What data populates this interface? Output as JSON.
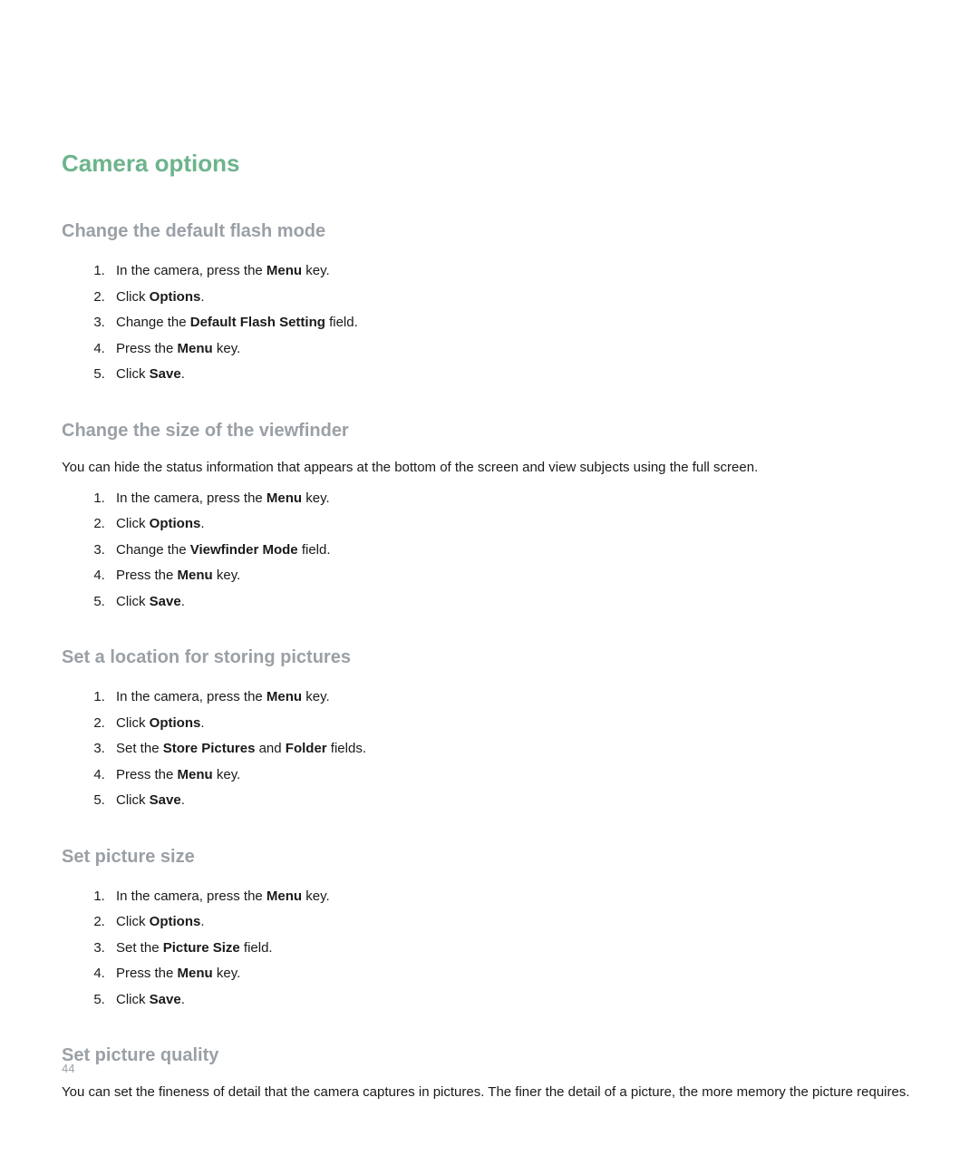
{
  "main_heading": "Camera options",
  "sections": [
    {
      "heading": "Change the default flash mode",
      "intro": "",
      "steps": [
        [
          [
            "In the camera, press the "
          ],
          [
            "Menu",
            true
          ],
          [
            " key."
          ]
        ],
        [
          [
            "Click "
          ],
          [
            "Options",
            true
          ],
          [
            "."
          ]
        ],
        [
          [
            "Change the "
          ],
          [
            "Default Flash Setting",
            true
          ],
          [
            " field."
          ]
        ],
        [
          [
            "Press the "
          ],
          [
            "Menu",
            true
          ],
          [
            " key."
          ]
        ],
        [
          [
            "Click "
          ],
          [
            "Save",
            true
          ],
          [
            "."
          ]
        ]
      ]
    },
    {
      "heading": "Change the size of the viewfinder",
      "intro": "You can hide the status information that appears at the bottom of the screen and view subjects using the full screen.",
      "steps": [
        [
          [
            "In the camera, press the "
          ],
          [
            "Menu",
            true
          ],
          [
            " key."
          ]
        ],
        [
          [
            "Click "
          ],
          [
            "Options",
            true
          ],
          [
            "."
          ]
        ],
        [
          [
            "Change the "
          ],
          [
            "Viewfinder Mode",
            true
          ],
          [
            " field."
          ]
        ],
        [
          [
            "Press the "
          ],
          [
            "Menu",
            true
          ],
          [
            " key."
          ]
        ],
        [
          [
            "Click "
          ],
          [
            "Save",
            true
          ],
          [
            "."
          ]
        ]
      ]
    },
    {
      "heading": "Set a location for storing pictures",
      "intro": "",
      "steps": [
        [
          [
            "In the camera, press the "
          ],
          [
            "Menu",
            true
          ],
          [
            " key."
          ]
        ],
        [
          [
            "Click "
          ],
          [
            "Options",
            true
          ],
          [
            "."
          ]
        ],
        [
          [
            "Set the "
          ],
          [
            "Store Pictures",
            true
          ],
          [
            " and "
          ],
          [
            "Folder",
            true
          ],
          [
            " fields."
          ]
        ],
        [
          [
            "Press the "
          ],
          [
            "Menu",
            true
          ],
          [
            " key."
          ]
        ],
        [
          [
            "Click "
          ],
          [
            "Save",
            true
          ],
          [
            "."
          ]
        ]
      ]
    },
    {
      "heading": "Set picture size",
      "intro": "",
      "steps": [
        [
          [
            "In the camera, press the "
          ],
          [
            "Menu",
            true
          ],
          [
            " key."
          ]
        ],
        [
          [
            "Click "
          ],
          [
            "Options",
            true
          ],
          [
            "."
          ]
        ],
        [
          [
            "Set the "
          ],
          [
            "Picture Size",
            true
          ],
          [
            " field."
          ]
        ],
        [
          [
            "Press the "
          ],
          [
            "Menu",
            true
          ],
          [
            " key."
          ]
        ],
        [
          [
            "Click "
          ],
          [
            "Save",
            true
          ],
          [
            "."
          ]
        ]
      ]
    },
    {
      "heading": "Set picture quality",
      "intro": "You can set the fineness of detail that the camera captures in pictures. The finer the detail of a picture, the more memory the picture requires.",
      "steps": []
    }
  ],
  "page_number": "44"
}
